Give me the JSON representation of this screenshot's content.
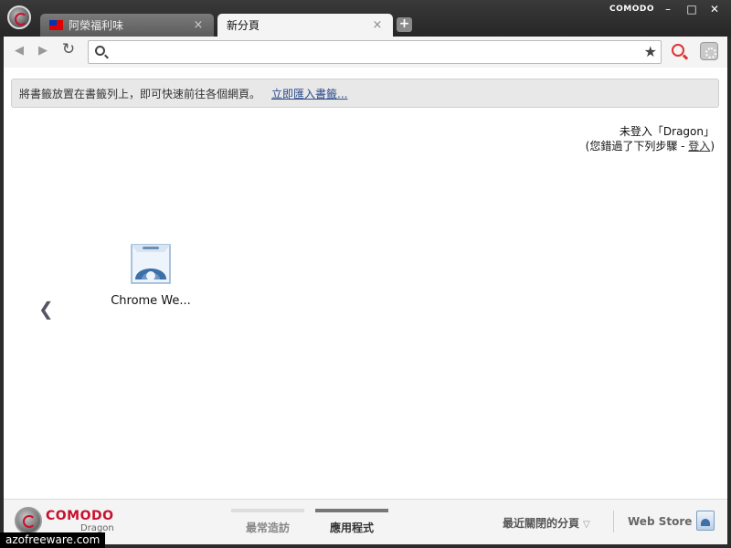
{
  "window": {
    "brand": "COMODO",
    "minimize_glyph": "–",
    "maximize_glyph": "□",
    "close_glyph": "✕"
  },
  "tabs": [
    {
      "label": "阿榮福利味",
      "icon": "taiwan-flag-icon",
      "close_glyph": "×"
    },
    {
      "label": "新分頁",
      "close_glyph": "×"
    }
  ],
  "new_tab_glyph": "+",
  "toolbar": {
    "back_glyph": "◀",
    "forward_glyph": "▶",
    "reload_glyph": "↻",
    "omnibox_value": "",
    "star_glyph": "★"
  },
  "bookmark_bar": {
    "hint": "將書籤放置在書籤列上，即可快速前往各個網頁。",
    "import_link": "立即匯入書籤..."
  },
  "signin": {
    "line1": "未登入「Dragon」",
    "line2_prefix": "(您錯過了下列步驟 - ",
    "link": "登入",
    "line2_suffix": ")"
  },
  "apps": {
    "prev_glyph": "❮",
    "items": [
      {
        "label": "Chrome We...",
        "icon": "chrome-web-store-icon"
      }
    ]
  },
  "footer": {
    "brand": "COMODO",
    "product": "Dragon",
    "tabs": [
      {
        "label": "最常造訪",
        "active": false
      },
      {
        "label": "應用程式",
        "active": true
      }
    ],
    "recent": "最近關閉的分頁",
    "recent_caret": "▽",
    "webstore": "Web Store"
  },
  "watermark": "azofreeware.com",
  "colors": {
    "brand_red": "#c8102e",
    "frame": "#2b2b2b",
    "link": "#2a4a8a"
  }
}
